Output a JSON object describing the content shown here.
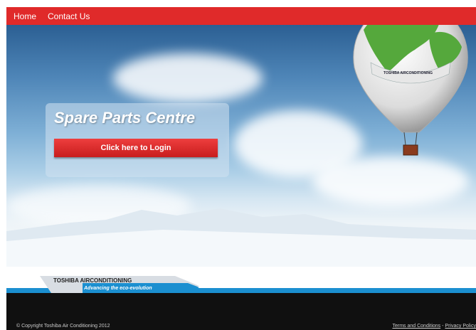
{
  "nav": {
    "items": [
      "Home",
      "Contact Us"
    ]
  },
  "hero": {
    "title": "Spare Parts Centre",
    "login_label": "Click here to Login",
    "balloon_label": "TOSHIBA AIRCONDITIONING"
  },
  "brand": {
    "name": "TOSHIBA AIRCONDITIONING",
    "tagline": "Advancing the eco-evolution"
  },
  "footer": {
    "copyright": "© Copyright Toshiba Air Conditioning 2012",
    "terms": "Terms and Conditions",
    "separator": " - ",
    "privacy": "Privacy Policy"
  },
  "colors": {
    "nav": "#e02a2a",
    "accent": "#1b8fd0",
    "footer": "#101010"
  }
}
